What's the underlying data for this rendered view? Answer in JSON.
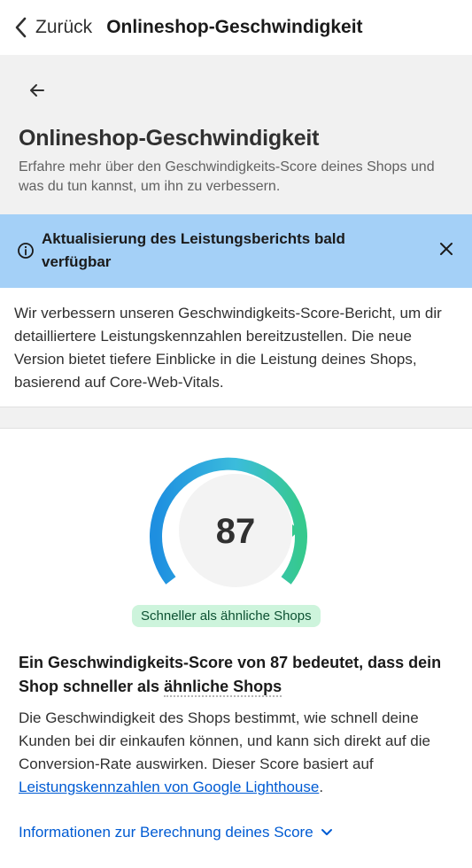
{
  "topbar": {
    "back_label": "Zurück",
    "title": "Onlineshop-Geschwindigkeit"
  },
  "header": {
    "title": "Onlineshop-Geschwindigkeit",
    "subtitle": "Erfahre mehr über den Geschwindigkeits-Score deines Shops und was du tun kannst, um ihn zu verbessern."
  },
  "banner": {
    "title": "Aktualisierung des Leistungsberichts bald verfügbar",
    "body": "Wir verbessern unseren Geschwindigkeits-Score-Bericht, um dir detailliertere Leistungskennzahlen bereitzustellen. Die neue Version bietet tiefere Einblicke in die Leistung deines Shops, basierend auf Core-Web-Vitals."
  },
  "score": {
    "value": "87",
    "badge": "Schneller als ähnliche Shops",
    "heading_prefix": "Ein Geschwindigkeits-Score von 87 bedeutet, dass dein Shop schneller als ",
    "heading_term": "ähnliche Shops",
    "desc_text": "Die Geschwindigkeit des Shops bestimmt, wie schnell deine Kunden bei dir einkaufen können, und kann sich direkt auf die Conversion-Rate auswirken. Dieser Score basiert auf ",
    "desc_link": "Leistungskennzahlen von Google Lighthouse",
    "desc_suffix": ".",
    "calc_link": "Informationen zur Berechnung deines Score"
  },
  "colors": {
    "accent": "#005bd3",
    "banner_bg": "#a4d0f7",
    "badge_bg": "#cdf4dc",
    "badge_text": "#0c5132",
    "gauge_start": "#1e8fe0",
    "gauge_end": "#36c98e"
  },
  "icons": {
    "back": "chevron-left-icon",
    "arrow": "arrow-left-icon",
    "info": "info-icon",
    "close": "close-icon",
    "expand": "chevron-down-icon"
  }
}
